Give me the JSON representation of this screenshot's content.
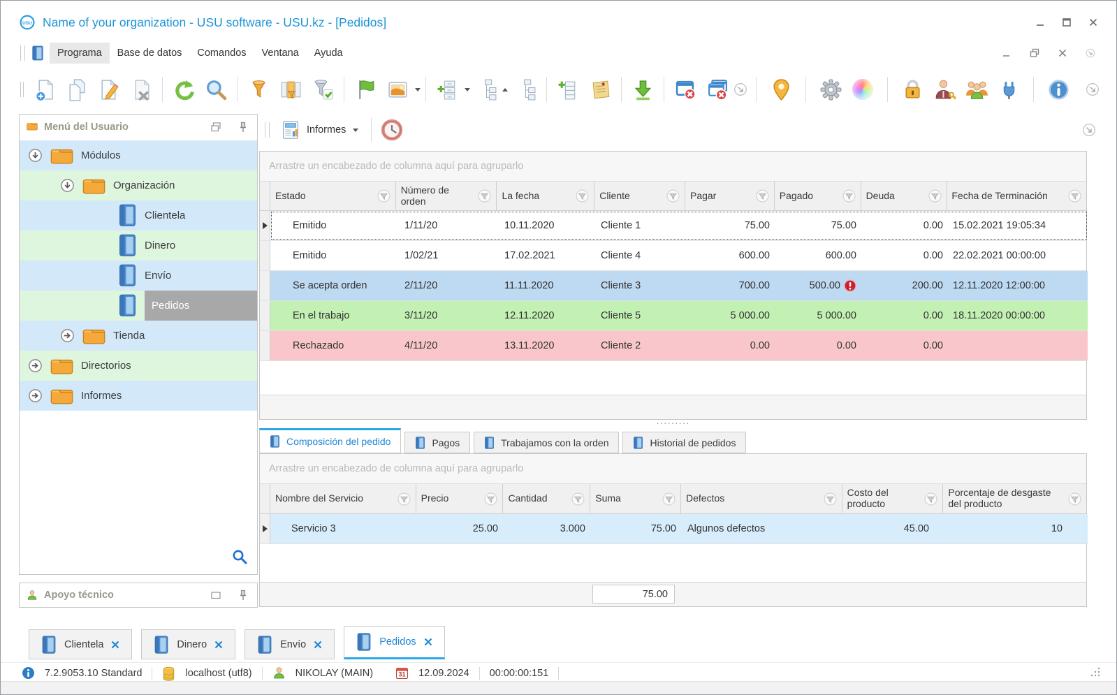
{
  "window": {
    "logo_text": "USU",
    "title": "Name of your organization - USU software - USU.kz - [Pedidos]"
  },
  "menu": {
    "items": [
      "Programa",
      "Base de datos",
      "Comandos",
      "Ventana",
      "Ayuda"
    ]
  },
  "toolbar": {
    "icons": [
      "new-record",
      "copy",
      "edit",
      "delete",
      "refresh",
      "search",
      "filter",
      "column-filter",
      "filter-check",
      "flag",
      "image",
      "grid-settings",
      "expand-tree",
      "collapse-tree",
      "add-row",
      "notes",
      "import",
      "close-window",
      "close-all-windows",
      "more-commands-left",
      "location-pin",
      "settings-gear",
      "color-palette",
      "lock",
      "user-rights",
      "users-group",
      "plugin",
      "info",
      "more-commands-right"
    ]
  },
  "sidebar": {
    "menu_panel_title": "Menú del Usuario",
    "support_panel_title": "Apoyo técnico",
    "tree": [
      {
        "label": "Módulos"
      },
      {
        "label": "Organización"
      },
      {
        "label": "Clientela"
      },
      {
        "label": "Dinero"
      },
      {
        "label": "Envío"
      },
      {
        "label": "Pedidos"
      },
      {
        "label": "Tienda"
      },
      {
        "label": "Directorios"
      },
      {
        "label": "Informes"
      }
    ]
  },
  "report_bar": {
    "button_label": "Informes"
  },
  "orders_grid": {
    "group_hint": "Arrastre un encabezado de columna aquí para agruparlo",
    "columns": [
      "Estado",
      "Número de orden",
      "La fecha",
      "Cliente",
      "Pagar",
      "Pagado",
      "Deuda",
      "Fecha de Terminación"
    ],
    "rows": [
      {
        "estado": "Emitido",
        "numero": "1/11/20",
        "fecha": "10.11.2020",
        "cliente": "Cliente 1",
        "pagar": "75.00",
        "pagado": "75.00",
        "deuda": "0.00",
        "terminacion": "15.02.2021 19:05:34"
      },
      {
        "estado": "Emitido",
        "numero": "1/02/21",
        "fecha": "17.02.2021",
        "cliente": "Cliente 4",
        "pagar": "600.00",
        "pagado": "600.00",
        "deuda": "0.00",
        "terminacion": "22.02.2021 00:00:00"
      },
      {
        "estado": "Se acepta orden",
        "numero": "2/11/20",
        "fecha": "11.11.2020",
        "cliente": "Cliente 3",
        "pagar": "700.00",
        "pagado": "500.00",
        "deuda": "200.00",
        "terminacion": "12.11.2020 12:00:00"
      },
      {
        "estado": "En el trabajo",
        "numero": "3/11/20",
        "fecha": "12.11.2020",
        "cliente": "Cliente 5",
        "pagar": "5 000.00",
        "pagado": "5 000.00",
        "deuda": "0.00",
        "terminacion": "18.11.2020 00:00:00"
      },
      {
        "estado": "Rechazado",
        "numero": "4/11/20",
        "fecha": "13.11.2020",
        "cliente": "Cliente 2",
        "pagar": "0.00",
        "pagado": "0.00",
        "deuda": "0.00",
        "terminacion": ""
      }
    ]
  },
  "detail_tabs": {
    "items": [
      {
        "label": "Composición del pedido"
      },
      {
        "label": "Pagos"
      },
      {
        "label": "Trabajamos con la orden"
      },
      {
        "label": "Historial de pedidos"
      }
    ]
  },
  "detail_grid": {
    "group_hint": "Arrastre un encabezado de columna aquí para agruparlo",
    "columns": [
      "Nombre del Servicio",
      "Precio",
      "Cantidad",
      "Suma",
      "Defectos",
      "Costo del producto",
      "Porcentaje de desgaste del producto"
    ],
    "rows": [
      {
        "nombre": "Servicio 3",
        "precio": "25.00",
        "cantidad": "3.000",
        "suma": "75.00",
        "defectos": "Algunos defectos",
        "costo": "45.00",
        "porcentaje": "10"
      }
    ],
    "suma_total": "75.00"
  },
  "window_tabs": {
    "items": [
      {
        "label": "Clientela"
      },
      {
        "label": "Dinero"
      },
      {
        "label": "Envío"
      },
      {
        "label": "Pedidos"
      }
    ]
  },
  "status_bar": {
    "version": "7.2.9053.10 Standard",
    "database": "localhost (utf8)",
    "user": "NIKOLAY (MAIN)",
    "calendar_icon_day": "31",
    "date": "12.09.2024",
    "timer": "00:00:00:151"
  },
  "colors": {
    "accent_blue": "#1d95d6",
    "tab_highlight": "#29a7e8",
    "row_blue": "#bed9f2",
    "row_green": "#c3f0b3",
    "row_red": "#f9c7cb",
    "row_lightblue": "#d7edfb",
    "tree_row_blue": "#d3e9fa",
    "tree_row_green": "#def5de",
    "selection_gray": "#a8a8a8"
  }
}
